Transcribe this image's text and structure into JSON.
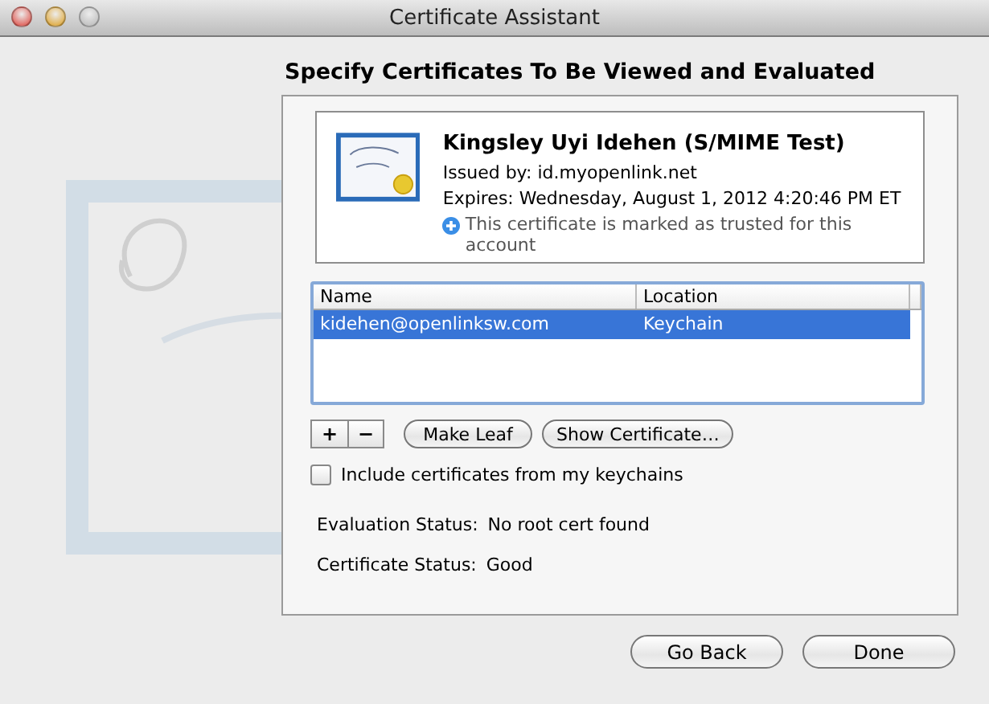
{
  "window": {
    "title": "Certificate Assistant"
  },
  "heading": "Specify Certificates To Be Viewed and Evaluated",
  "certificate": {
    "name": "Kingsley Uyi Idehen (S/MIME Test)",
    "issued_by": "Issued by: id.myopenlink.net",
    "expires": "Expires: Wednesday, August 1, 2012 4:20:46 PM ET",
    "trust_note": "This certificate is marked as trusted for this account"
  },
  "table": {
    "columns": [
      "Name",
      "Location"
    ],
    "rows": [
      {
        "cells": [
          "kidehen@openlinksw.com",
          "Keychain"
        ],
        "selected": true
      }
    ]
  },
  "list_buttons": [
    "+",
    "−"
  ],
  "actions": [
    "Make Leaf",
    "Show Certificate…"
  ],
  "include_keychains": {
    "label": "Include certificates from my keychains",
    "checked": false
  },
  "statuses": [
    {
      "label": "Evaluation Status:",
      "value": "No root cert found"
    },
    {
      "label": "Certificate Status:",
      "value": "Good"
    }
  ],
  "buttons": [
    "Go Back",
    "Done"
  ]
}
